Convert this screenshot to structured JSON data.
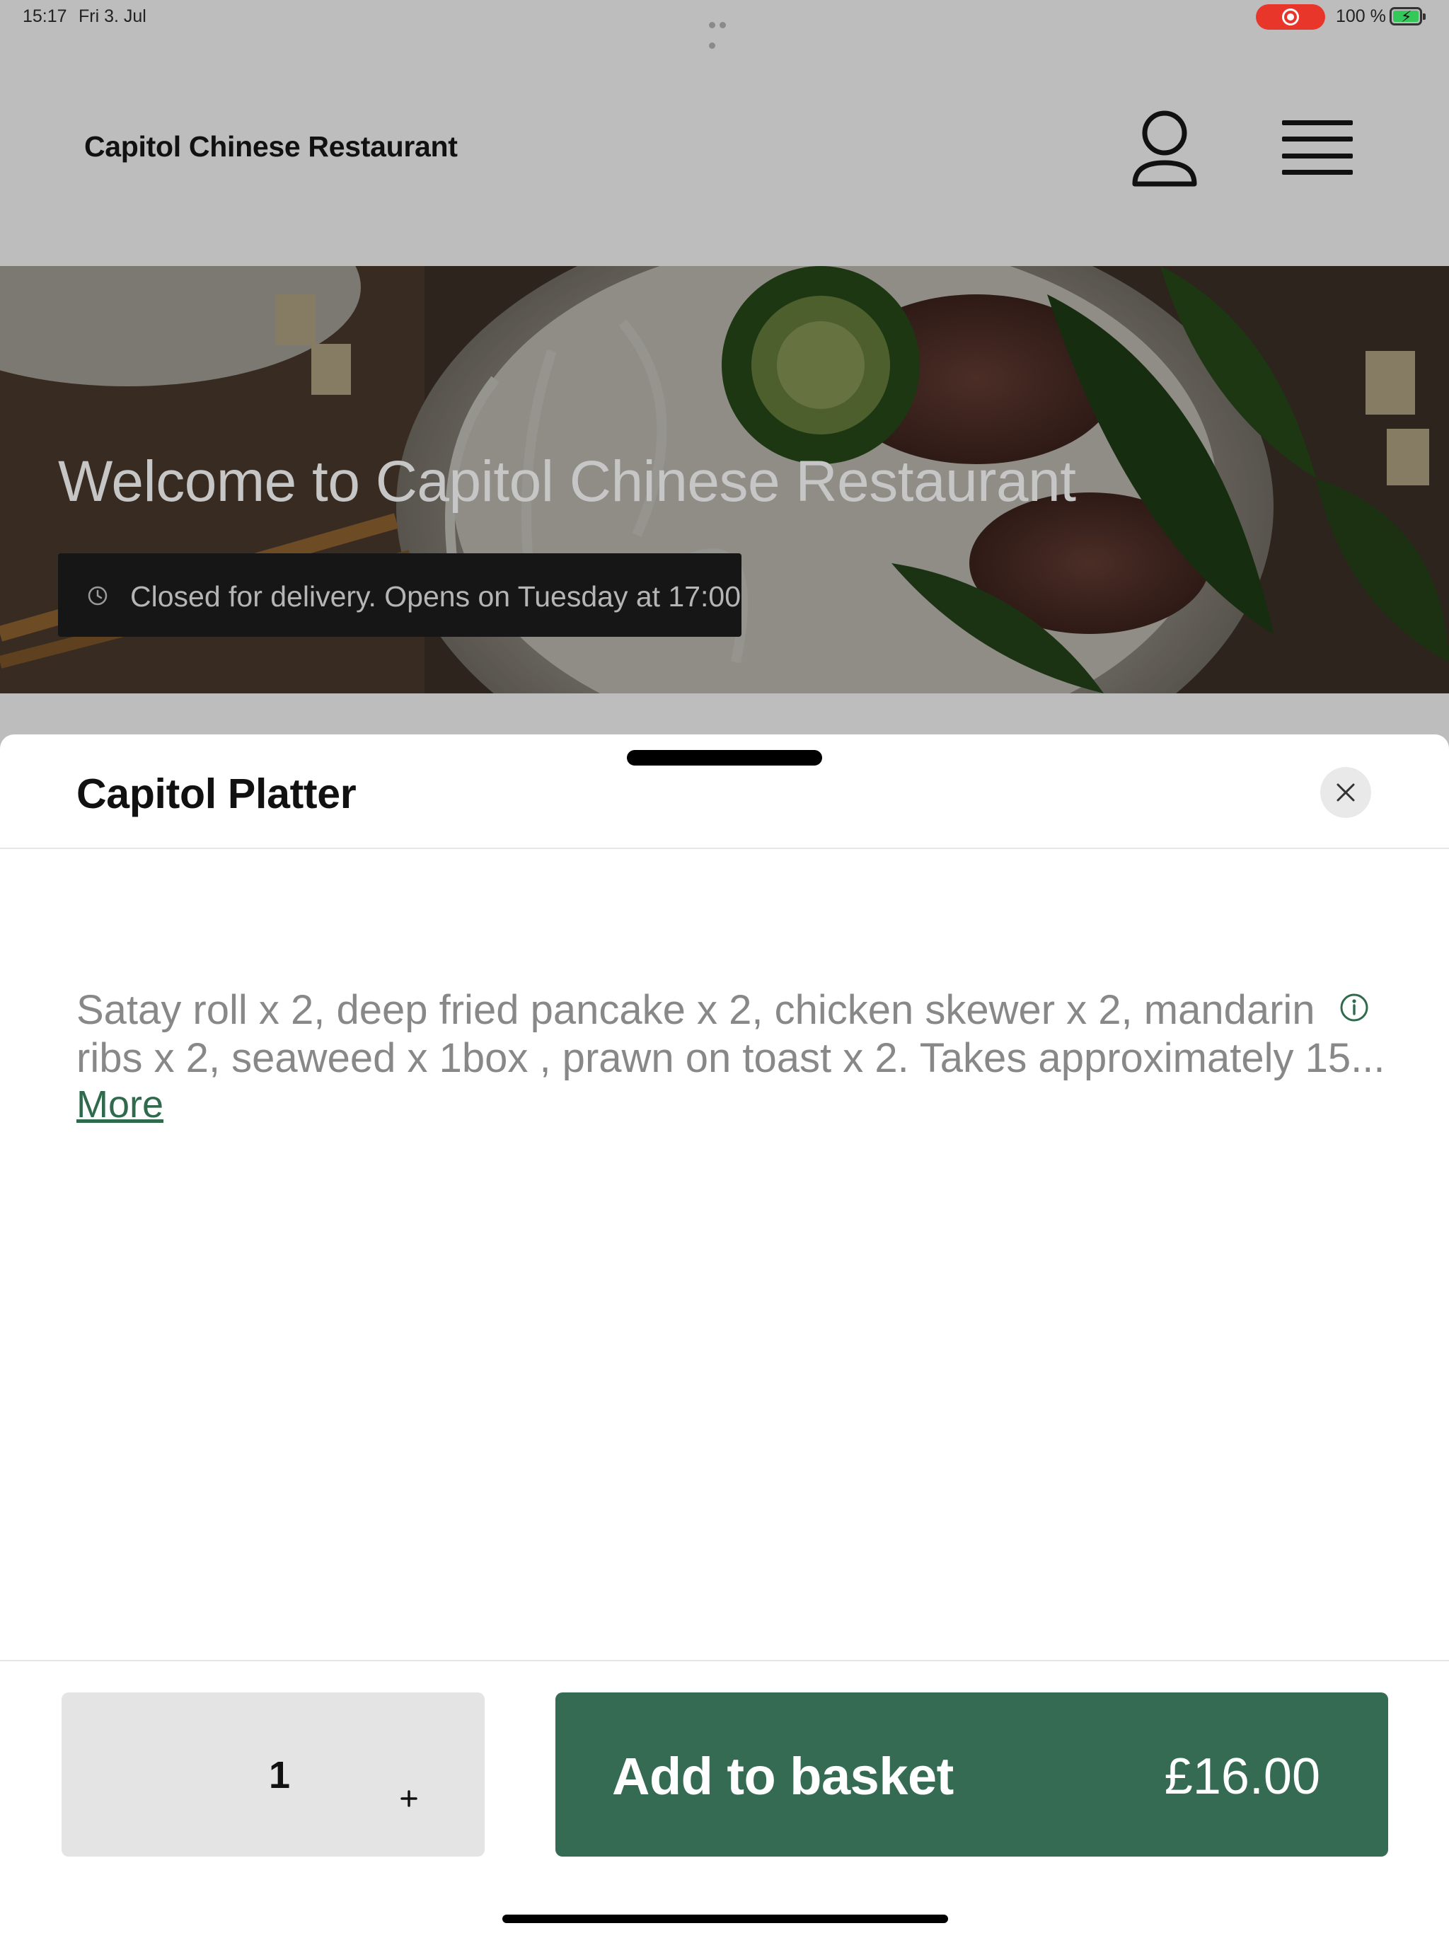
{
  "status_bar": {
    "time": "15:17",
    "date": "Fri 3. Jul",
    "battery_percent": "100 %",
    "icons": [
      "multitask-dots-icon",
      "screen-recording-icon",
      "battery-charging-icon"
    ],
    "recording_color": "#e8362b",
    "battery_color": "#34c759"
  },
  "header": {
    "brand": "Capitol Chinese Restaurant",
    "icons": [
      "profile-icon",
      "hamburger-menu-icon"
    ]
  },
  "hero": {
    "title": "Welcome to Capitol Chinese Restaurant",
    "status_text": "Closed for delivery. Opens on Tuesday at 17:00",
    "status_icon": "clock-icon"
  },
  "item_sheet": {
    "title": "Capitol Platter",
    "close_icon": "close-icon",
    "description_lines": [
      "Satay roll x 2, deep fried pancake x 2, chicken skewer x 2, mandarin",
      "ribs x 2, seaweed x 1box , prawn on toast x 2. Takes approximately 15..."
    ],
    "more_label": "More",
    "info_icon": "info-icon",
    "link_color": "#2f6a4d"
  },
  "footer": {
    "quantity": "1",
    "increment_icon": "plus-icon",
    "add_label": "Add to basket",
    "price": "£16.00",
    "accent_color": "#346b52"
  }
}
